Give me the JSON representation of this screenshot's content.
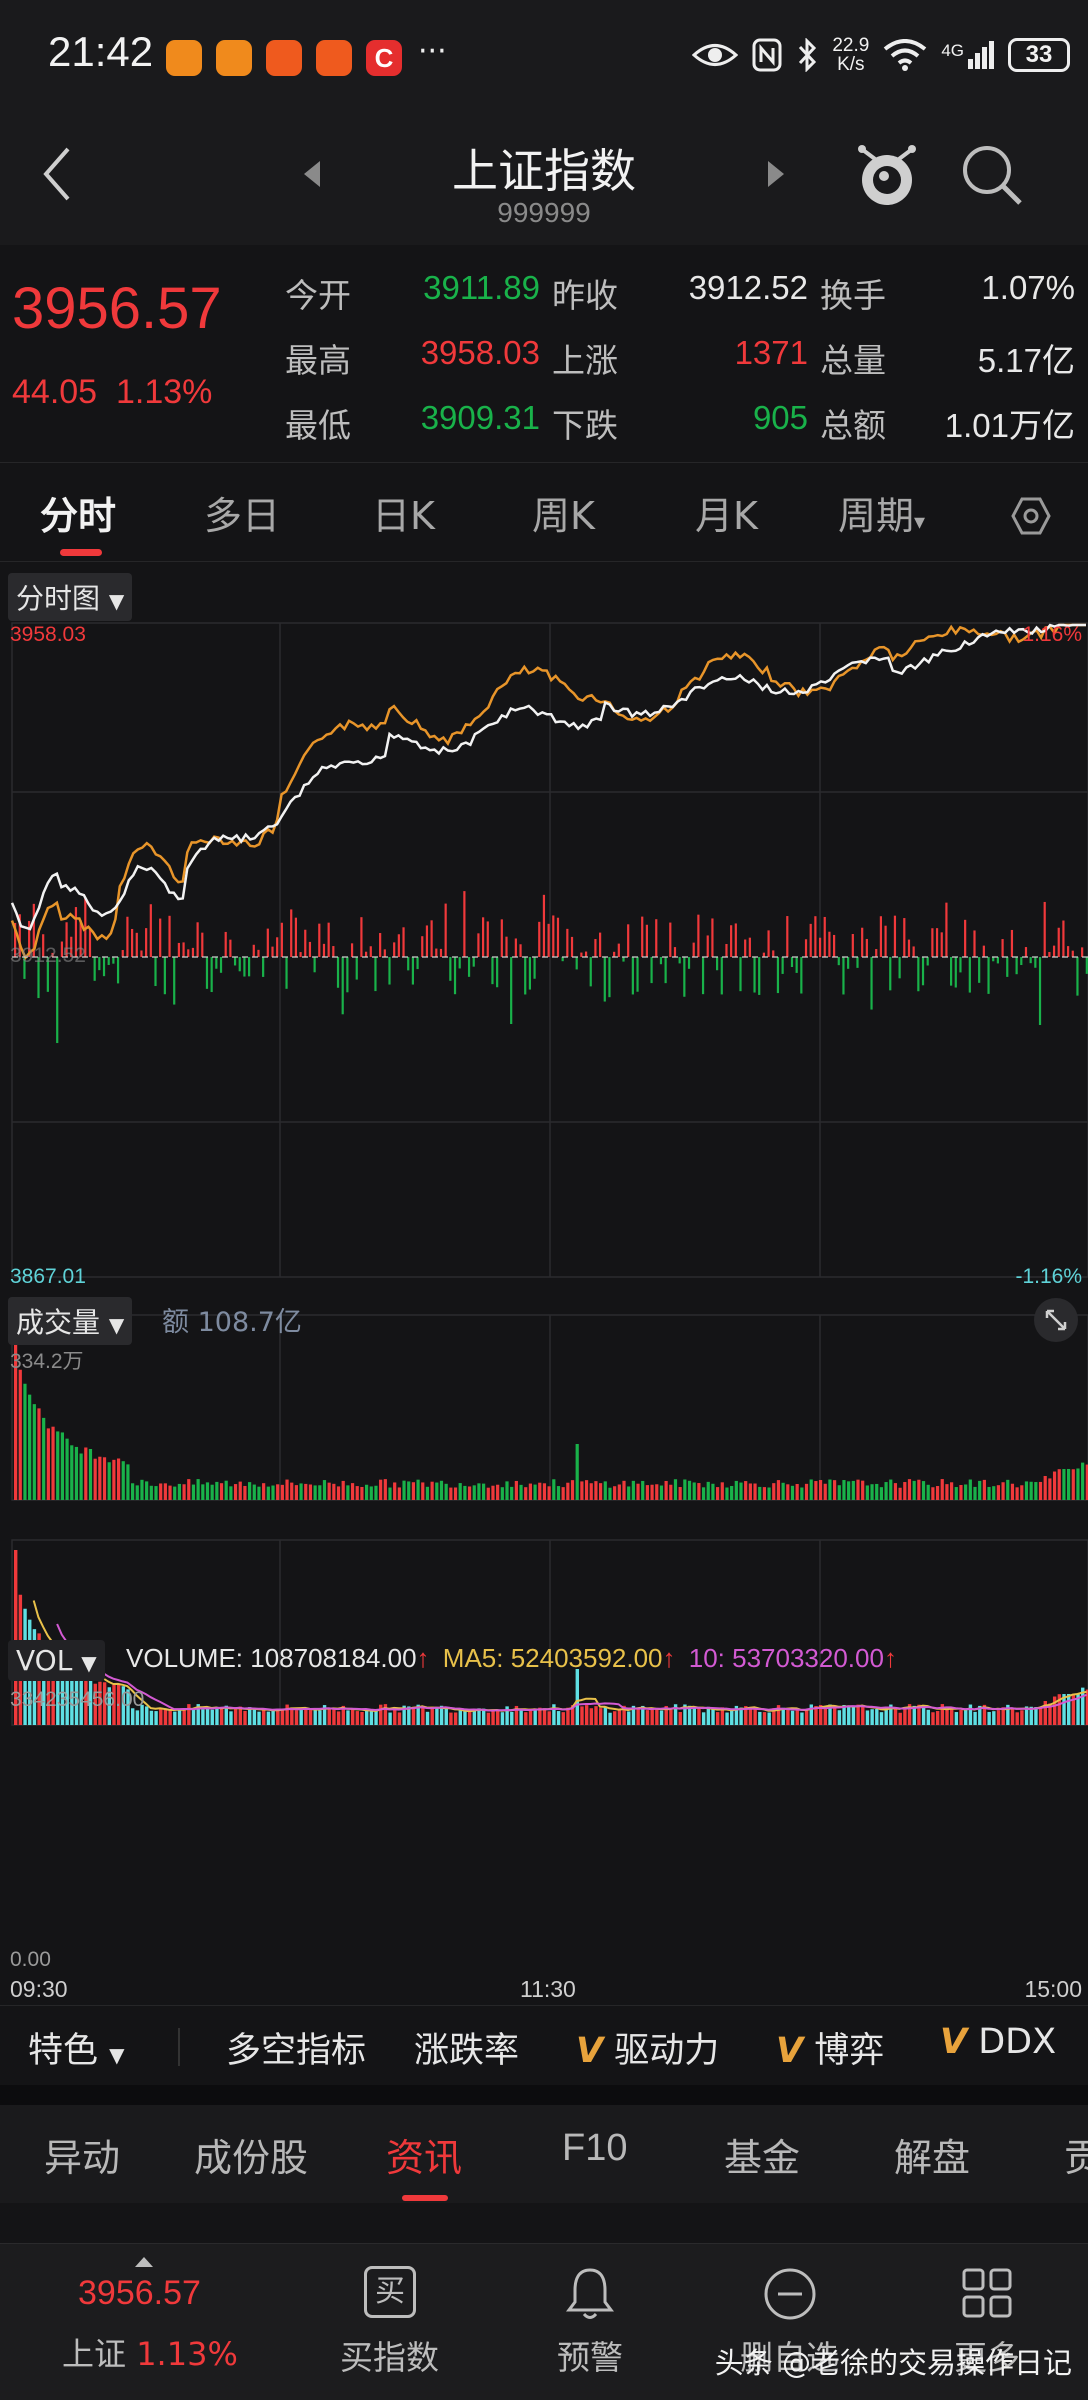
{
  "status_bar": {
    "time": "21:42",
    "net_speed_value": "22.9",
    "net_speed_unit": "K/s",
    "network_type": "4G",
    "battery": "33"
  },
  "nav": {
    "title": "上证指数",
    "code": "999999"
  },
  "quote": {
    "price": "3956.57",
    "change": "44.05",
    "change_pct": "1.13%",
    "rows": [
      {
        "l1": "今开",
        "v1": "3911.89",
        "l2": "昨收",
        "v2": "3912.52",
        "l3": "换手",
        "v3": "1.07%"
      },
      {
        "l1": "最高",
        "v1": "3958.03",
        "l2": "上涨",
        "v2": "1371",
        "l3": "总量",
        "v3": "5.17亿"
      },
      {
        "l1": "最低",
        "v1": "3909.31",
        "l2": "下跌",
        "v2": "905",
        "l3": "总额",
        "v3": "1.01万亿"
      }
    ],
    "colors": {
      "up": "#f0393b",
      "down": "#19b24a"
    }
  },
  "period_tabs": [
    "分时",
    "多日",
    "日K",
    "周K",
    "月K",
    "周期"
  ],
  "intraday": {
    "dropdown": "分时图",
    "high_label": "3958.03",
    "low_label": "3867.01",
    "high_pct": "1.16%",
    "low_pct": "-1.16%",
    "mid_label": "3912.52"
  },
  "volume": {
    "dropdown": "成交量",
    "amount_label": "额 108.7亿",
    "max_label": "334.2万"
  },
  "vol_indicator": {
    "dropdown": "VOL",
    "volume_text": "VOLUME: 108708184.00",
    "ma5_text": "MA5: 52403592.00",
    "ma10_text": "10: 53703320.00",
    "max_label": "334235456.00",
    "zero_label": "0.00",
    "time_start": "09:30",
    "time_mid": "11:30",
    "time_end": "15:00"
  },
  "indicator_tabs": {
    "special": "特色",
    "items": [
      "多空指标",
      "涨跌率",
      "驱动力",
      "博弈",
      "DDX"
    ],
    "v_mark": "V"
  },
  "info_tabs": [
    "异动",
    "成份股",
    "资讯",
    "F10",
    "基金",
    "解盘",
    "贡"
  ],
  "bottom_bar": {
    "price": "3956.57",
    "name": "上证",
    "pct": "1.13%",
    "items": [
      "买指数",
      "预警",
      "删自选",
      "更多"
    ],
    "buy_icon_char": "买"
  },
  "watermark": "头条 @老徐的交易操作日记"
}
